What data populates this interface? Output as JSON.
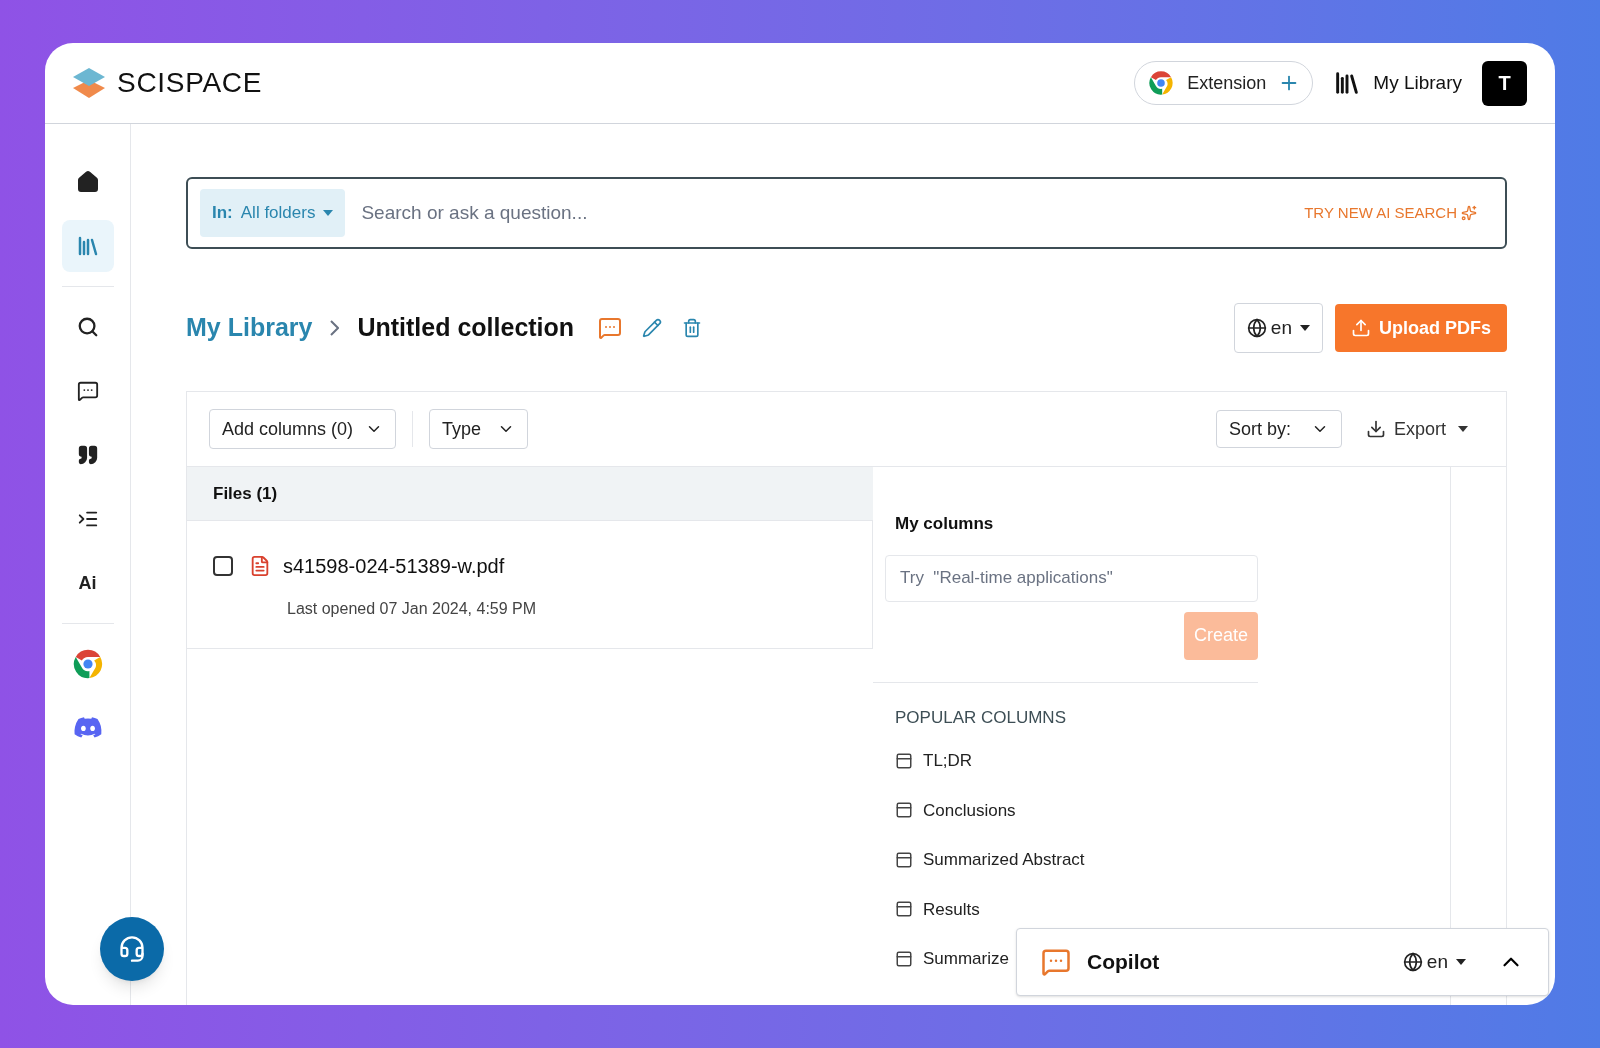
{
  "brand": {
    "name": "SCISPACE"
  },
  "header": {
    "extension_label": "Extension",
    "library_label": "My Library",
    "avatar_letter": "T"
  },
  "sidebar": {
    "items": [
      {
        "kind": "home",
        "selected": false
      },
      {
        "kind": "library",
        "selected": true
      },
      {
        "kind": "divider"
      },
      {
        "kind": "search",
        "selected": false
      },
      {
        "kind": "chat",
        "selected": false
      },
      {
        "kind": "quote",
        "selected": false
      },
      {
        "kind": "outline",
        "selected": false
      },
      {
        "kind": "ai",
        "selected": false,
        "label": "Ai"
      },
      {
        "kind": "divider"
      },
      {
        "kind": "chrome",
        "selected": false
      },
      {
        "kind": "discord",
        "selected": false
      }
    ]
  },
  "search": {
    "scope_prefix": "In:",
    "scope_value": "All folders",
    "placeholder": "Search or ask a question...",
    "ai_link": "TRY NEW AI SEARCH"
  },
  "breadcrumb": {
    "parent": "My Library",
    "current": "Untitled collection"
  },
  "language": "en",
  "upload_label": "Upload PDFs",
  "toolbar": {
    "add_columns": "Add columns (0)",
    "type": "Type",
    "sort": "Sort by:",
    "export": "Export"
  },
  "files": {
    "heading": "Files (1)",
    "rows": [
      {
        "name": "s41598-024-51389-w.pdf",
        "meta": "Last opened 07 Jan 2024, 4:59 PM",
        "checked": false
      }
    ]
  },
  "columns_panel": {
    "title": "My columns",
    "placeholder": "Try  \"Real-time applications\"",
    "create_label": "Create",
    "create_disabled": true,
    "popular_heading": "POPULAR COLUMNS",
    "popular": [
      "TL;DR",
      "Conclusions",
      "Summarized Abstract",
      "Results",
      "Summarize"
    ]
  },
  "copilot": {
    "title": "Copilot",
    "language": "en",
    "expanded": false
  }
}
